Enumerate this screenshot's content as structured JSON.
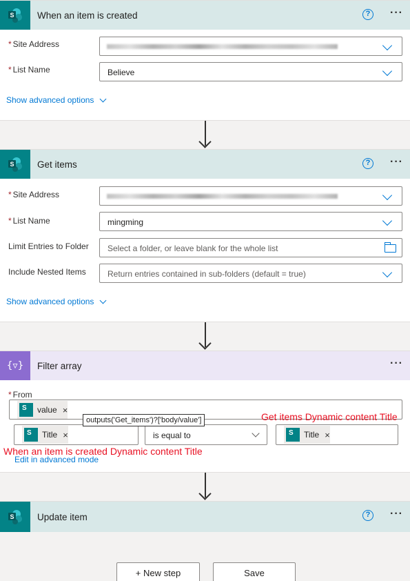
{
  "trigger": {
    "title": "When an item is created",
    "site_label": "Site Address",
    "list_label": "List Name",
    "list_value": "Believe",
    "show_advanced": "Show advanced options",
    "help": "?",
    "more": "···"
  },
  "get_items": {
    "title": "Get items",
    "site_label": "Site Address",
    "list_label": "List Name",
    "list_value": "mingming",
    "limit_label": "Limit Entries to Folder",
    "limit_placeholder": "Select a folder, or leave blank for the whole list",
    "nested_label": "Include Nested Items",
    "nested_placeholder": "Return entries contained in sub-folders (default = true)",
    "show_advanced": "Show advanced options",
    "help": "?",
    "more": "···"
  },
  "filter": {
    "title": "Filter array",
    "icon": "{▿}",
    "from_label": "From",
    "from_token": "value",
    "left_token": "Title",
    "operator": "is equal to",
    "right_token": "Title",
    "edit_advanced": "Edit in advanced mode",
    "tooltip": "outputs('Get_items')?['body/value']",
    "more": "···"
  },
  "update": {
    "title": "Update item",
    "help": "?",
    "more": "···"
  },
  "annotations": {
    "right": "Get items Dynamic content Title",
    "left": "When an item is created Dynamic content Title"
  },
  "footer": {
    "new_step": "+ New step",
    "save": "Save"
  },
  "colors": {
    "sharepoint": "#038387",
    "filter": "#8c6cd0",
    "link": "#0078d4",
    "annotation": "#e81123"
  }
}
